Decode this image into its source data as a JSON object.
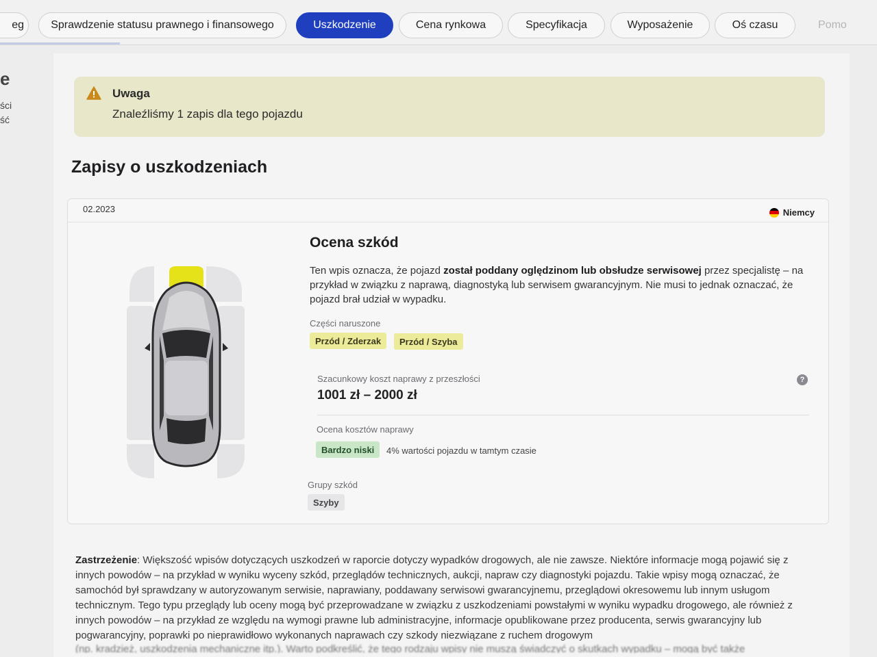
{
  "tabs": [
    {
      "label": "eg",
      "state": "partial"
    },
    {
      "label": "Sprawdzenie statusu prawnego i finansowego",
      "state": "normal"
    },
    {
      "label": "Uszkodzenie",
      "state": "active"
    },
    {
      "label": "Cena rynkowa",
      "state": "normal"
    },
    {
      "label": "Specyfikacja",
      "state": "normal"
    },
    {
      "label": "Wyposażenie",
      "state": "normal"
    },
    {
      "label": "Oś czasu",
      "state": "normal"
    },
    {
      "label": "Pomo",
      "state": "faded"
    }
  ],
  "sidebar_fragments": [
    "e",
    "ści",
    "ść"
  ],
  "alert": {
    "title": "Uwaga",
    "text": "Znaleźliśmy 1 zapis dla tego pojazdu",
    "icon": "warning-icon"
  },
  "section_title": "Zapisy o uszkodzeniach",
  "record": {
    "date": "02.2023",
    "country": "Niemcy",
    "flag_colors": [
      "#000000",
      "#dd0000",
      "#ffce00"
    ],
    "heading": "Ocena szkód",
    "description_pre": "Ten wpis oznacza, że pojazd ",
    "description_bold": "został poddany oględzinom lub obsłudze serwisowej",
    "description_post": " przez specjalistę – na przykład w związku z naprawą, diagnostyką lub serwisem gwarancyjnym. Nie musi to jednak oznaczać, że pojazd brał udział w wypadku.",
    "parts_label": "Części naruszone",
    "parts": [
      "Przód / Zderzak",
      "Przód / Szyba"
    ],
    "cost_label": "Szacunkowy koszt naprawy z przeszłości",
    "cost_value": "1001 zł – 2000 zł",
    "help_icon": "?",
    "rating_label": "Ocena kosztów naprawy",
    "rating_value": "Bardzo niski",
    "rating_note": "4% wartości pojazdu w tamtym czasie",
    "groups_label": "Grupy szkód",
    "groups": [
      "Szyby"
    ],
    "damaged_zone_color": "#e6e21a"
  },
  "disclaimer": {
    "title": "Zastrzeżenie",
    "text": ": Większość wpisów dotyczących uszkodzeń w raporcie dotyczy wypadków drogowych, ale nie zawsze. Niektóre informacje mogą pojawić się z innych powodów – na przykład w wyniku wyceny szkód, przeglądów technicznych, aukcji, napraw czy diagnostyki pojazdu. Takie wpisy mogą oznaczać, że samochód był sprawdzany w autoryzowanym serwisie, naprawiany, poddawany serwisowi gwarancyjnemu, przeglądowi okresowemu lub innym usługom technicznym. Tego typu przeglądy lub oceny mogą być przeprowadzane w związku z uszkodzeniami powstałymi w wyniku wypadku drogowego, ale również z innych powodów – na przykład ze względu na wymogi prawne lub administracyjne, informacje opublikowane przez producenta, serwis gwarancyjny lub pogwarancyjny, poprawki po nieprawidłowo wykonanych naprawach czy szkody niezwiązane z ruchem drogowym",
    "cut_line": "(np. kradzież, uszkodzenia mechaniczne itp.). Warto podkreślić, że tego rodzaju wpisy nie muszą świadczyć o skutkach wypadku – mogą być także"
  }
}
